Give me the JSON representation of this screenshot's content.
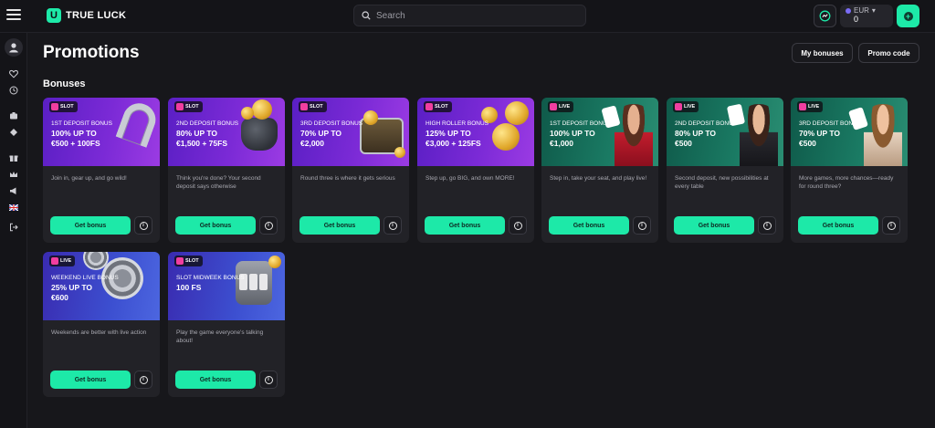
{
  "header": {
    "logo_mark": "U",
    "logo_text": "TRUE LUCK",
    "search_placeholder": "Search",
    "wallet": {
      "currency": "EUR",
      "amount": "0"
    },
    "deposit_symbol": "+"
  },
  "page": {
    "title": "Promotions",
    "my_bonuses_label": "My bonuses",
    "promo_code_label": "Promo code",
    "section_title": "Bonuses"
  },
  "cards": [
    {
      "badge": "SLOT",
      "kicker": "1ST DEPOSIT BONUS",
      "headline": "100% UP TO\n€500 + 100FS",
      "desc": "Join in, gear up, and go wild!",
      "button": "Get bonus",
      "theme": "slot",
      "art": "horseshoe"
    },
    {
      "badge": "SLOT",
      "kicker": "2ND DEPOSIT BONUS",
      "headline": "80% UP TO\n€1,500 + 75FS",
      "desc": "Think you're done? Your second deposit says otherwise",
      "button": "Get bonus",
      "theme": "slot",
      "art": "pot-of-gold"
    },
    {
      "badge": "SLOT",
      "kicker": "3RD DEPOSIT BONUS",
      "headline": "70% UP TO\n€2,000",
      "desc": "Round three is where it gets serious",
      "button": "Get bonus",
      "theme": "slot",
      "art": "treasure-chest"
    },
    {
      "badge": "SLOT",
      "kicker": "HIGH ROLLER BONUS",
      "headline": "125% UP TO\n€3,000 + 125FS",
      "desc": "Step up, go BIG, and own MORE!",
      "button": "Get bonus",
      "theme": "slot",
      "art": "gold-coins"
    },
    {
      "badge": "LIVE",
      "kicker": "1ST DEPOSIT BONUS",
      "headline": "100% UP TO\n€1,000",
      "desc": "Step in, take your seat, and play live!",
      "button": "Get bonus",
      "theme": "live",
      "art": "dealer-red"
    },
    {
      "badge": "LIVE",
      "kicker": "2ND DEPOSIT BONUS",
      "headline": "80% UP TO\n€500",
      "desc": "Second deposit, new possibilities at every table",
      "button": "Get bonus",
      "theme": "live",
      "art": "dealer-dark"
    },
    {
      "badge": "LIVE",
      "kicker": "3RD DEPOSIT BONUS",
      "headline": "70% UP TO\n€500",
      "desc": "More games, more chances—ready for round three?",
      "button": "Get bonus",
      "theme": "live",
      "art": "dealer-light"
    },
    {
      "badge": "LIVE",
      "kicker": "WEEKEND LIVE BONUS",
      "headline": "25% UP TO\n€600",
      "desc": "Weekends are better with live action",
      "button": "Get bonus",
      "theme": "blue",
      "art": "casino-chip"
    },
    {
      "badge": "SLOT",
      "kicker": "SLOT MIDWEEK BONUS",
      "headline": "100 FS",
      "desc": "Play the game everyone's talking about!",
      "button": "Get bonus",
      "theme": "blue",
      "art": "slot-machine"
    }
  ],
  "sidebar_icons": [
    "avatar-icon",
    "heart-icon",
    "history-icon",
    "casino-icon",
    "live-casino-icon",
    "gift-icon",
    "crown-icon",
    "megaphone-icon",
    "uk-flag-icon",
    "logout-icon"
  ],
  "colors": {
    "accent": "#1de9a8",
    "background": "#17171b",
    "card": "#222227",
    "slot_banner": "#7b2ad6",
    "live_banner": "#1a7a63",
    "blue_banner": "#3c4fd0"
  }
}
